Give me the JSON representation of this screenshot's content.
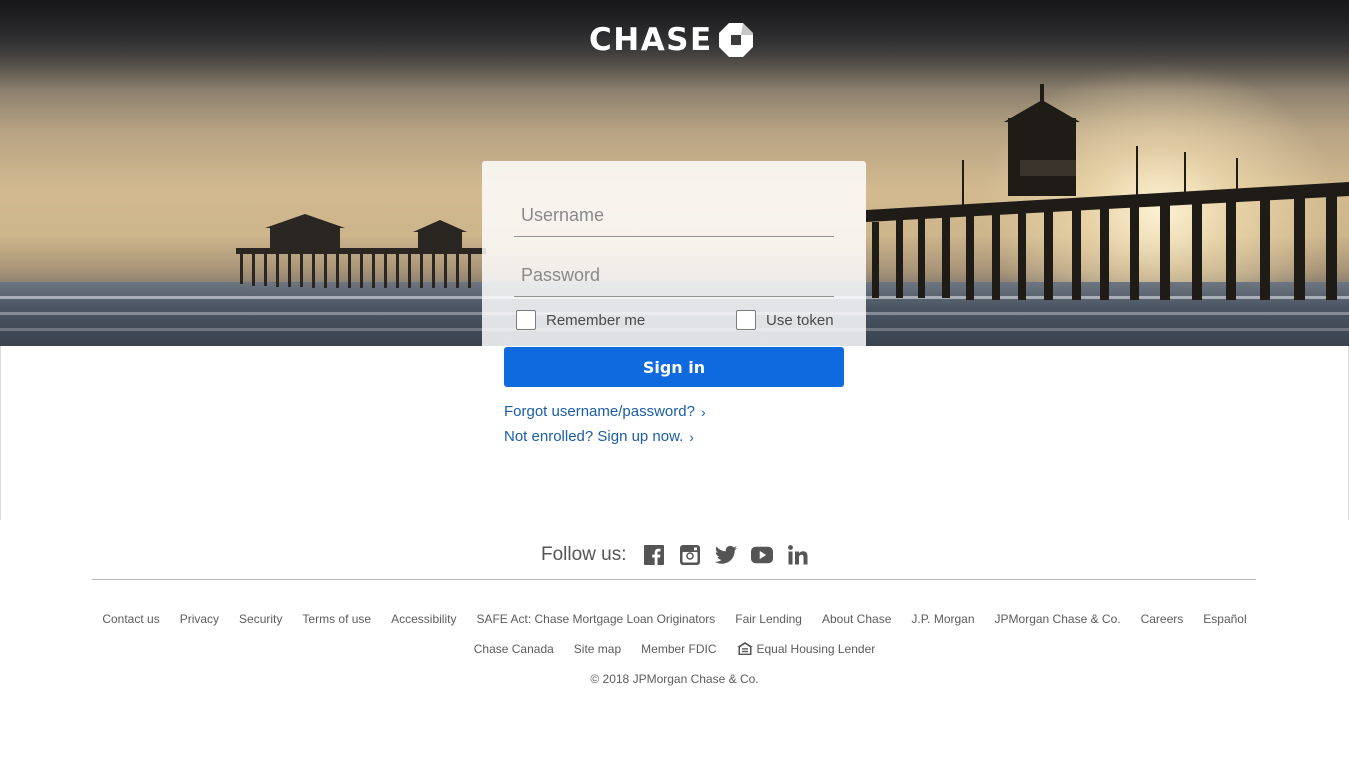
{
  "brand": {
    "name": "CHASE"
  },
  "login": {
    "username_placeholder": "Username",
    "password_placeholder": "Password",
    "remember_label": "Remember me",
    "token_label": "Use token",
    "signin_label": "Sign in",
    "forgot_label": "Forgot username/password?",
    "enroll_label": "Not enrolled? Sign up now."
  },
  "footer": {
    "follow_label": "Follow us:",
    "social": [
      "facebook-icon",
      "instagram-icon",
      "twitter-icon",
      "youtube-icon",
      "linkedin-icon"
    ],
    "links_row1": [
      "Contact us",
      "Privacy",
      "Security",
      "Terms of use",
      "Accessibility",
      "SAFE Act: Chase Mortgage Loan Originators",
      "Fair Lending",
      "About Chase",
      "J.P. Morgan",
      "JPMorgan Chase & Co.",
      "Careers",
      "Español"
    ],
    "links_row2": [
      "Chase Canada",
      "Site map",
      "Member FDIC",
      "Equal Housing Lender"
    ],
    "copyright": "© 2018  JPMorgan Chase & Co."
  },
  "colors": {
    "primary": "#0f6ae0",
    "link": "#1a5da8",
    "footer_text": "#5c5c5c"
  }
}
